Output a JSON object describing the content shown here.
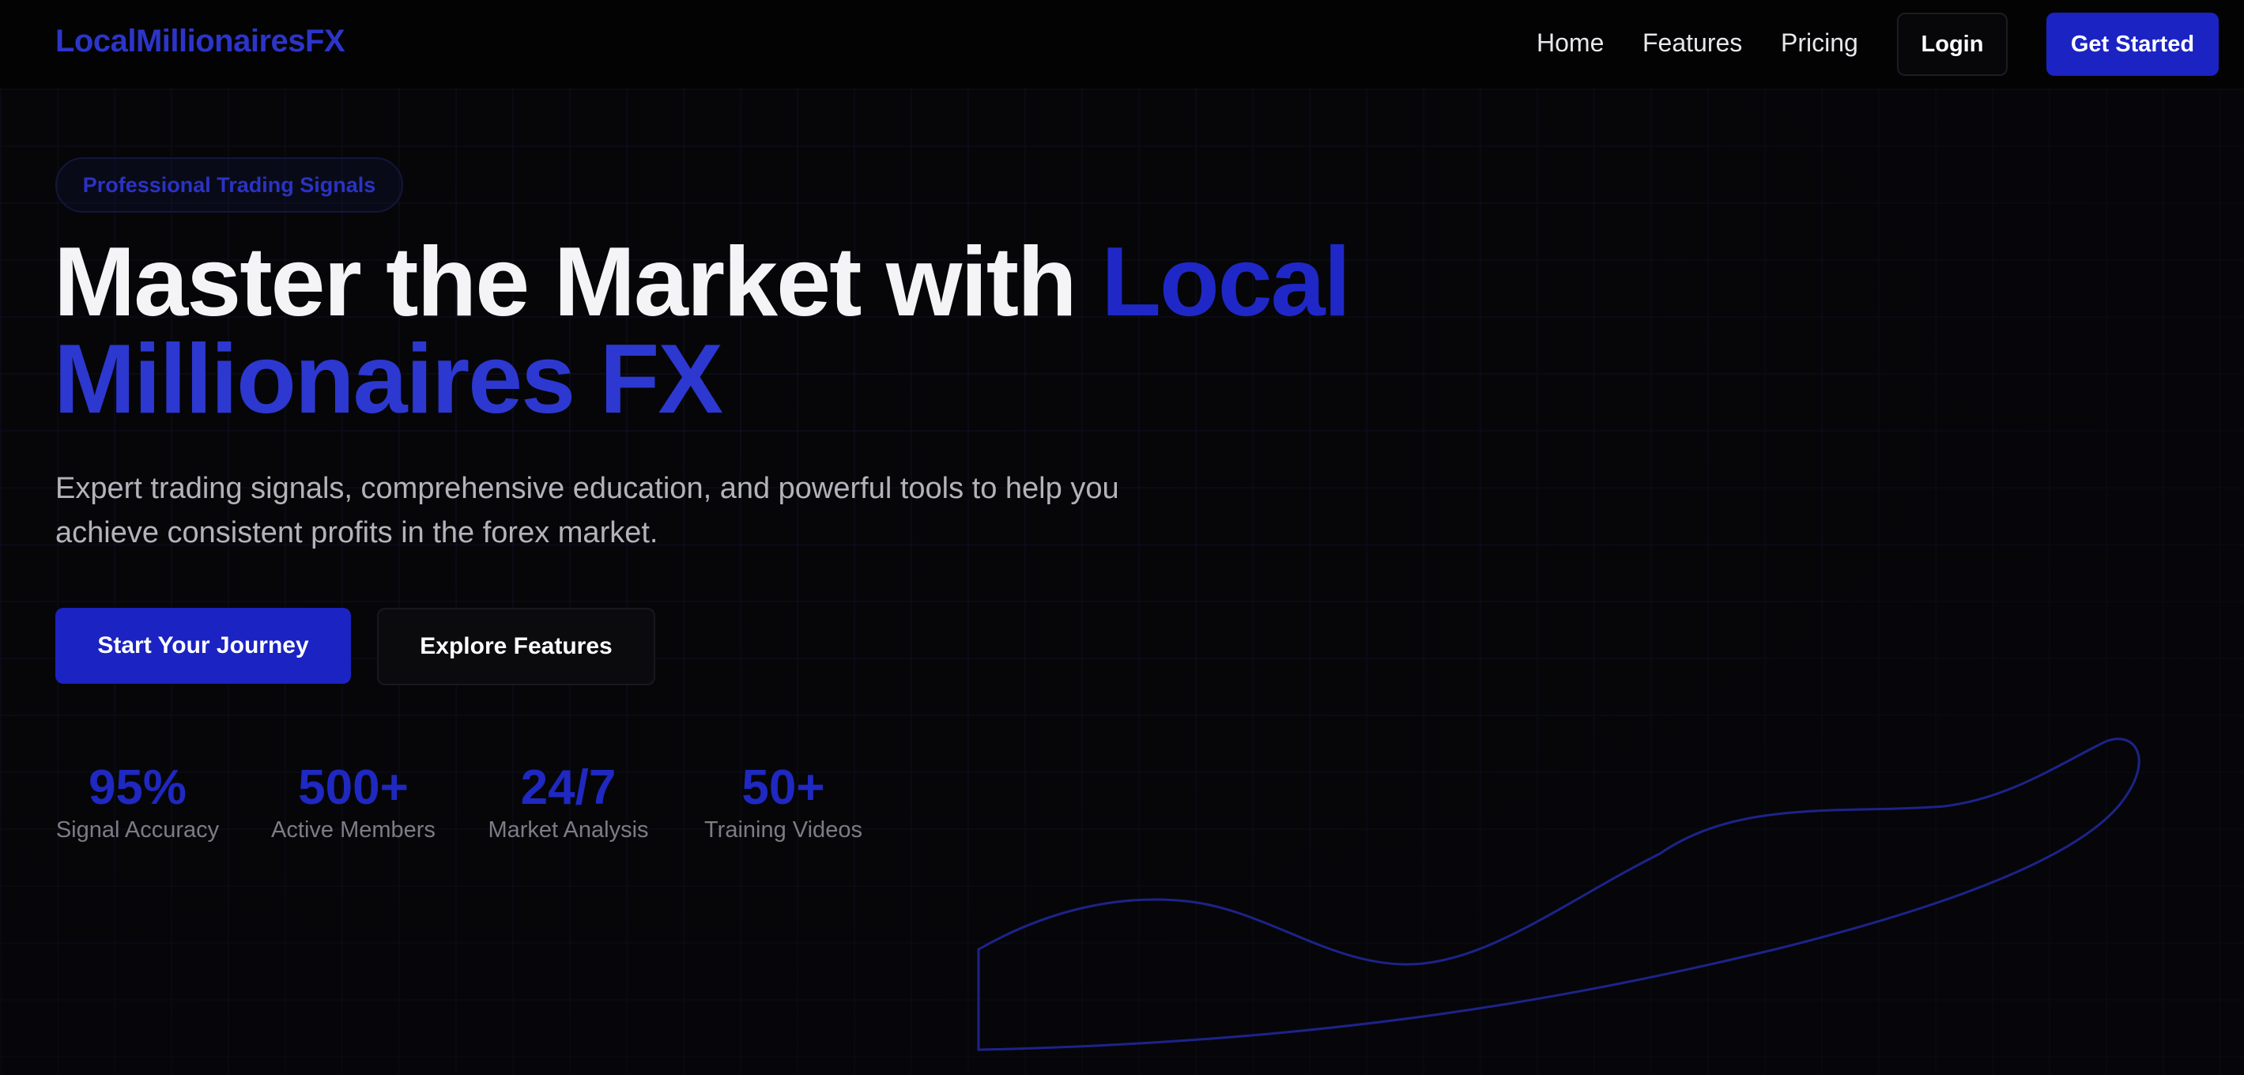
{
  "nav": {
    "logo": "LocalMillionairesFX",
    "links": [
      "Home",
      "Features",
      "Pricing"
    ],
    "login_label": "Login",
    "get_started_label": "Get Started"
  },
  "hero": {
    "badge": "Professional Trading Signals",
    "headline_white": "Master the Market with ",
    "headline_blue_1": "Local",
    "headline_blue_2": "Millionaires FX",
    "subtitle": "Expert trading signals, comprehensive education, and powerful tools to help you achieve consistent profits in the forex market.",
    "primary_cta": "Start Your Journey",
    "secondary_cta": "Explore Features"
  },
  "stats": [
    {
      "value": "95%",
      "label": "Signal Accuracy"
    },
    {
      "value": "500+",
      "label": "Active Members"
    },
    {
      "value": "24/7",
      "label": "Market Analysis"
    },
    {
      "value": "50+",
      "label": "Training Videos"
    }
  ],
  "colors": {
    "accent": "#1b23c3",
    "background": "#060608",
    "text": "#f4f4f6",
    "muted": "#7c7c85"
  }
}
